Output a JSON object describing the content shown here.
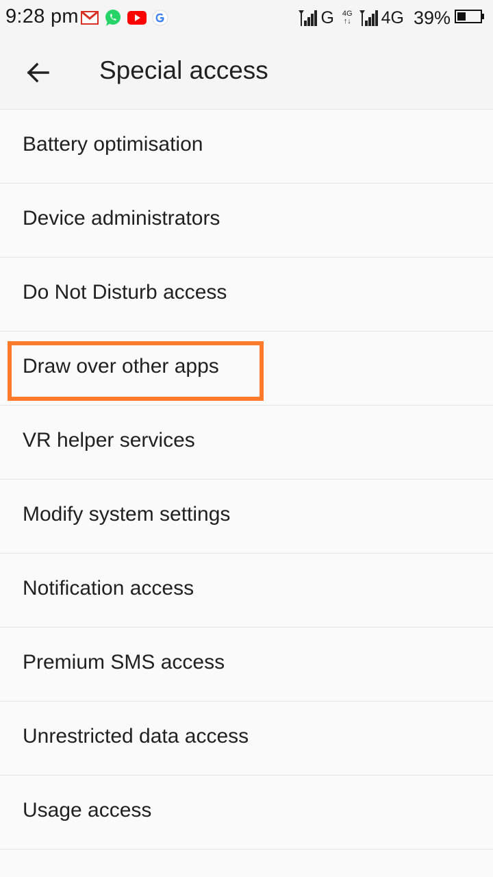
{
  "status_bar": {
    "time": "9:28 pm",
    "notification_icons": [
      "gmail-icon",
      "whatsapp-icon",
      "youtube-icon",
      "google-icon"
    ],
    "network_1": "G",
    "network_2": "4G",
    "network_mini_top": "4G",
    "network_mini_bottom": "↑↓",
    "battery_percent": "39%",
    "battery_level": 0.39
  },
  "app_bar": {
    "title": "Special access",
    "back_icon": "back-arrow-icon"
  },
  "list": {
    "items": [
      {
        "label": "Battery optimisation"
      },
      {
        "label": "Device administrators"
      },
      {
        "label": "Do Not Disturb access"
      },
      {
        "label": "Draw over other apps"
      },
      {
        "label": "VR helper services"
      },
      {
        "label": "Modify system settings"
      },
      {
        "label": "Notification access"
      },
      {
        "label": "Premium SMS access"
      },
      {
        "label": "Unrestricted data access"
      },
      {
        "label": "Usage access"
      }
    ]
  },
  "colors": {
    "highlight": "#ff7a2a",
    "gmail": "#d93025",
    "whatsapp": "#25d366",
    "youtube": "#ff0000"
  }
}
